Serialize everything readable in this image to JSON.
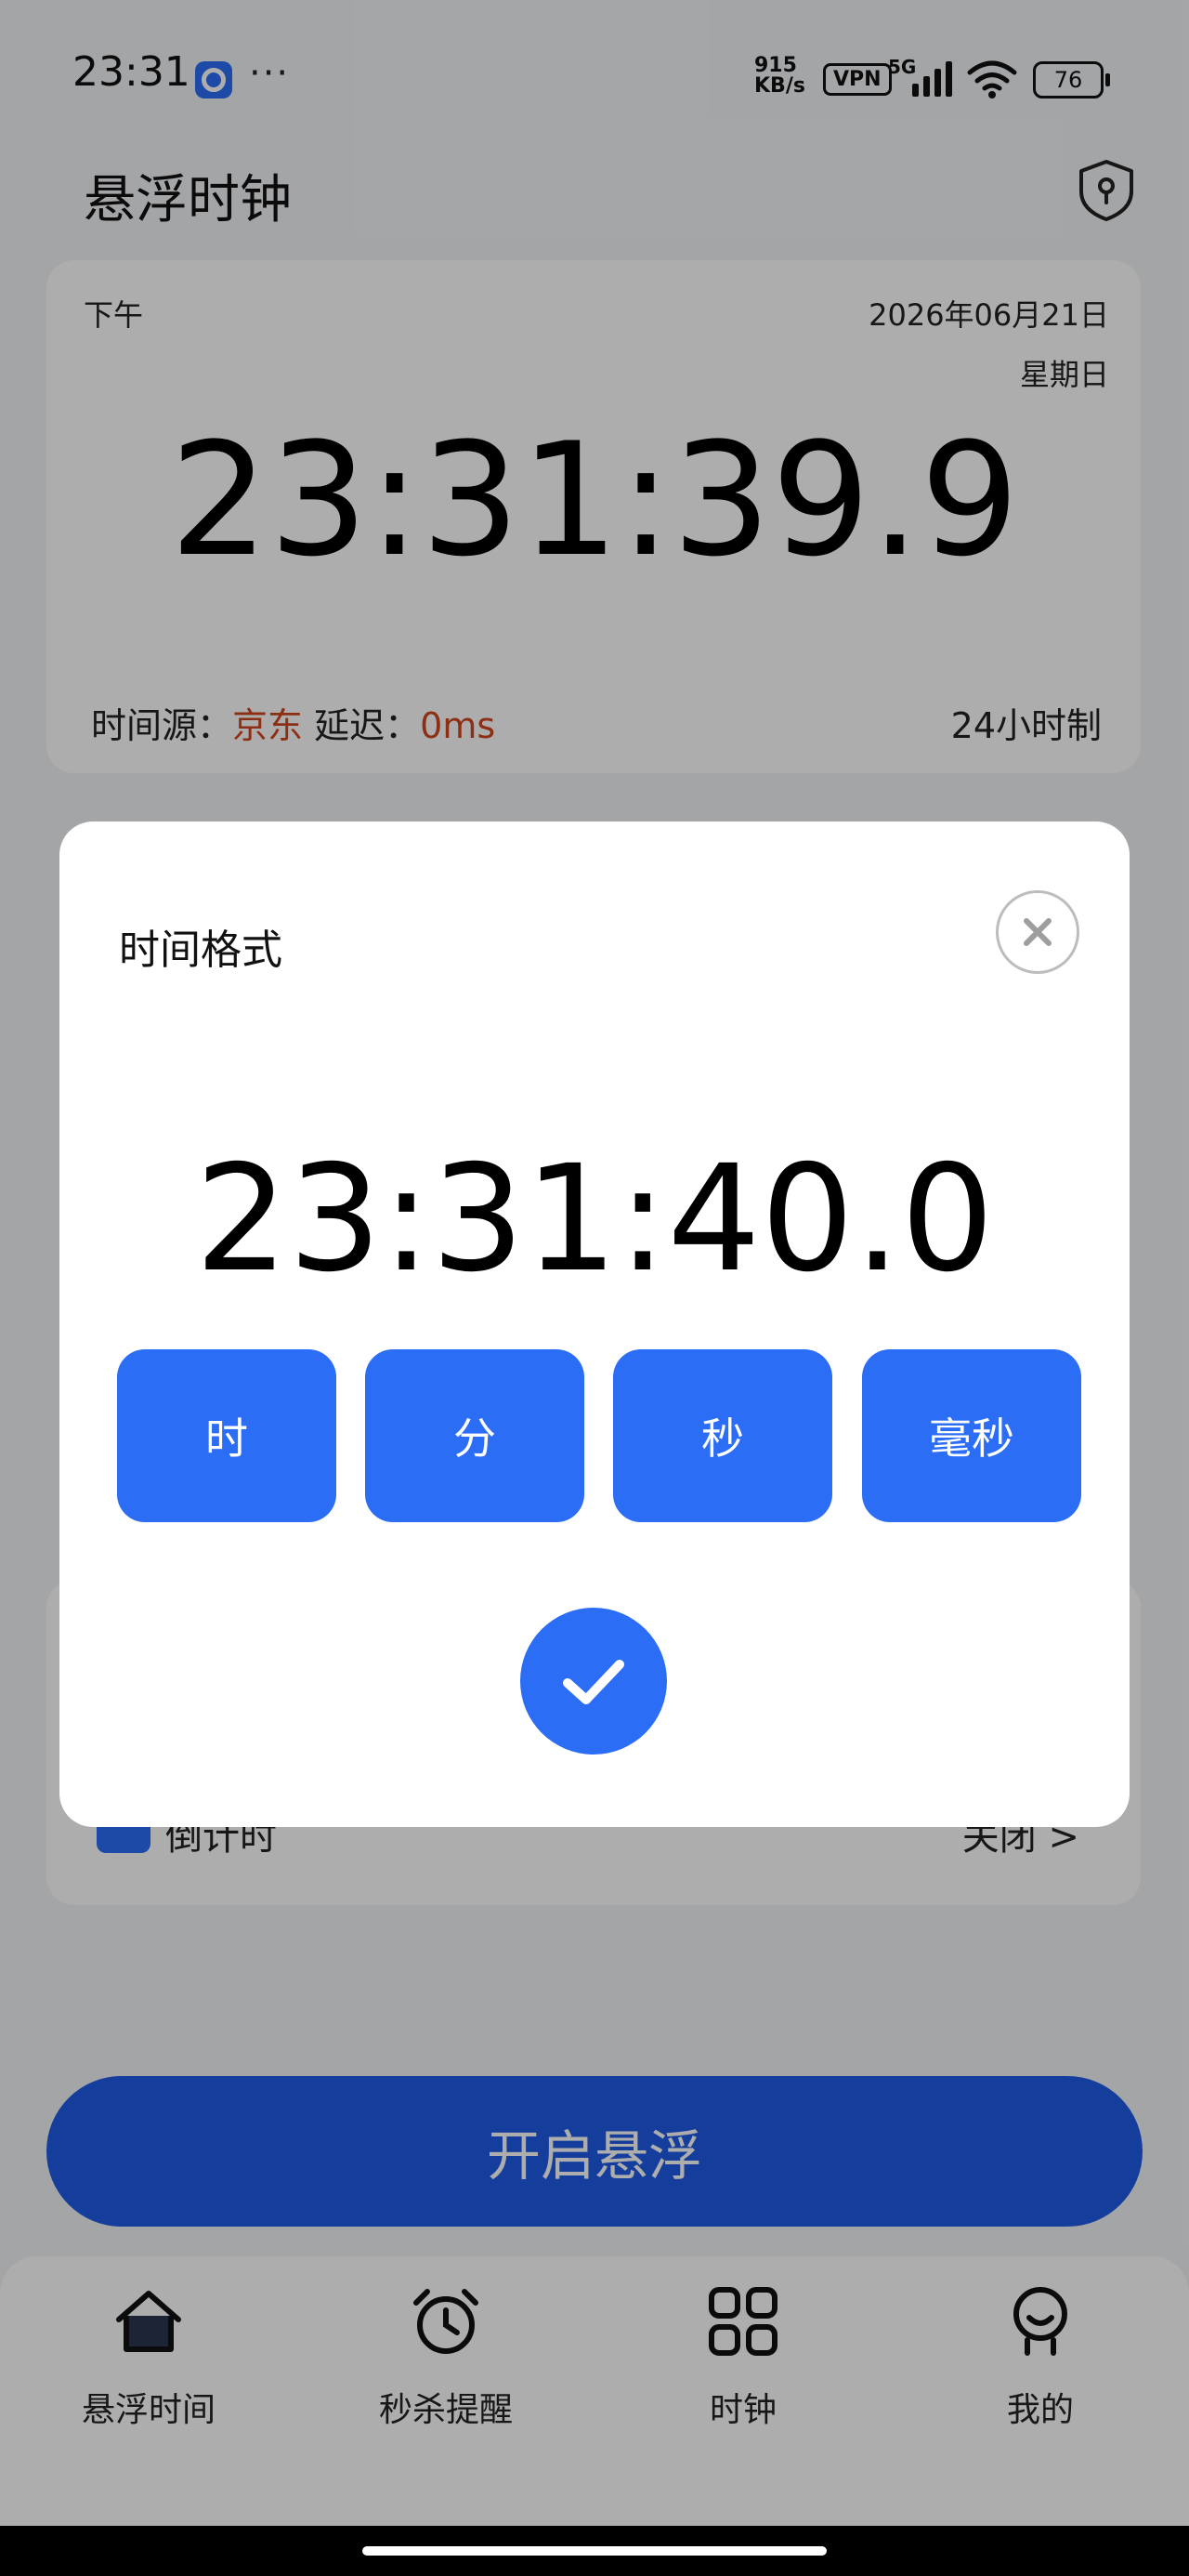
{
  "status_bar": {
    "time": "23:31",
    "dots": "···",
    "speed_value": "915",
    "speed_unit": "KB/s",
    "vpn": "VPN",
    "network": "5G",
    "battery": "76"
  },
  "header": {
    "title": "悬浮时钟",
    "shield_icon": "shield-keyhole-icon"
  },
  "clock_card": {
    "ampm": "下午",
    "date": "2026年06月21日",
    "weekday": "星期日",
    "time": "23:31:39.9",
    "source_label": "时间源：",
    "source_value": "京东",
    "delay_label": "延迟：",
    "delay_value": "0ms",
    "hour_format": "24小时制"
  },
  "background_list": {
    "countdown_label": "倒计时",
    "countdown_value": "关闭 >"
  },
  "primary_button": {
    "label": "开启悬浮"
  },
  "bottom_nav": {
    "items": [
      {
        "label": "悬浮时间",
        "icon": "home-icon"
      },
      {
        "label": "秒杀提醒",
        "icon": "alarm-clock-icon"
      },
      {
        "label": "时钟",
        "icon": "grid-icon"
      },
      {
        "label": "我的",
        "icon": "profile-icon"
      }
    ]
  },
  "dialog": {
    "title": "时间格式",
    "preview_time": "23:31:40.0",
    "units": [
      "时",
      "分",
      "秒",
      "毫秒"
    ],
    "close_icon": "close-icon",
    "confirm_icon": "checkmark-icon"
  },
  "colors": {
    "accent": "#2b6df5",
    "primary_button": "#1f5ce6",
    "highlight_red": "#d0461e",
    "background": "#f2f4f7"
  }
}
